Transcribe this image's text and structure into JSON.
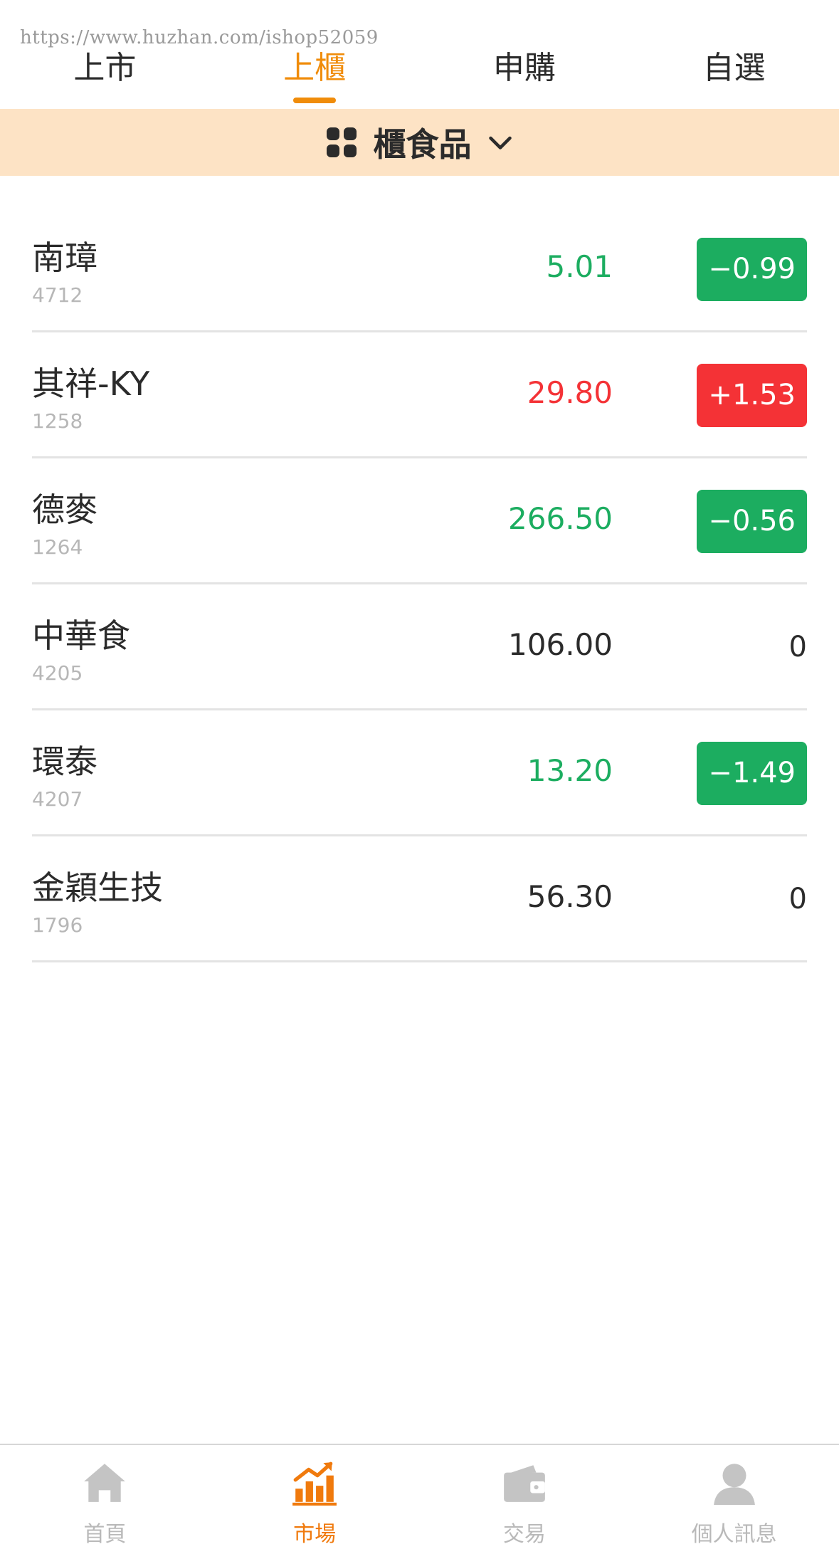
{
  "watermark": "https://www.huzhan.com/ishop52059",
  "colors": {
    "accent": "#f08c0a",
    "up": "#f43236",
    "down": "#1cad60",
    "category_bg": "#fde3c5"
  },
  "tabs": [
    {
      "label": "上市",
      "active": false
    },
    {
      "label": "上櫃",
      "active": true
    },
    {
      "label": "申購",
      "active": false
    },
    {
      "label": "自選",
      "active": false
    }
  ],
  "category": {
    "label": "櫃食品",
    "icon": "grid-icon",
    "dropdown_icon": "chevron-down-icon"
  },
  "stocks": [
    {
      "name": "南璋",
      "code": "4712",
      "price": "5.01",
      "change": "−0.99",
      "direction": "down"
    },
    {
      "name": "其祥-KY",
      "code": "1258",
      "price": "29.80",
      "change": "+1.53",
      "direction": "up"
    },
    {
      "name": "德麥",
      "code": "1264",
      "price": "266.50",
      "change": "−0.56",
      "direction": "down"
    },
    {
      "name": "中華食",
      "code": "4205",
      "price": "106.00",
      "change": "0",
      "direction": "flat"
    },
    {
      "name": "環泰",
      "code": "4207",
      "price": "13.20",
      "change": "−1.49",
      "direction": "down"
    },
    {
      "name": "金穎生技",
      "code": "1796",
      "price": "56.30",
      "change": "0",
      "direction": "flat"
    }
  ],
  "bottom_nav": [
    {
      "label": "首頁",
      "icon": "home-icon",
      "active": false
    },
    {
      "label": "市場",
      "icon": "market-chart-icon",
      "active": true
    },
    {
      "label": "交易",
      "icon": "wallet-icon",
      "active": false
    },
    {
      "label": "個人訊息",
      "icon": "user-icon",
      "active": false
    }
  ]
}
